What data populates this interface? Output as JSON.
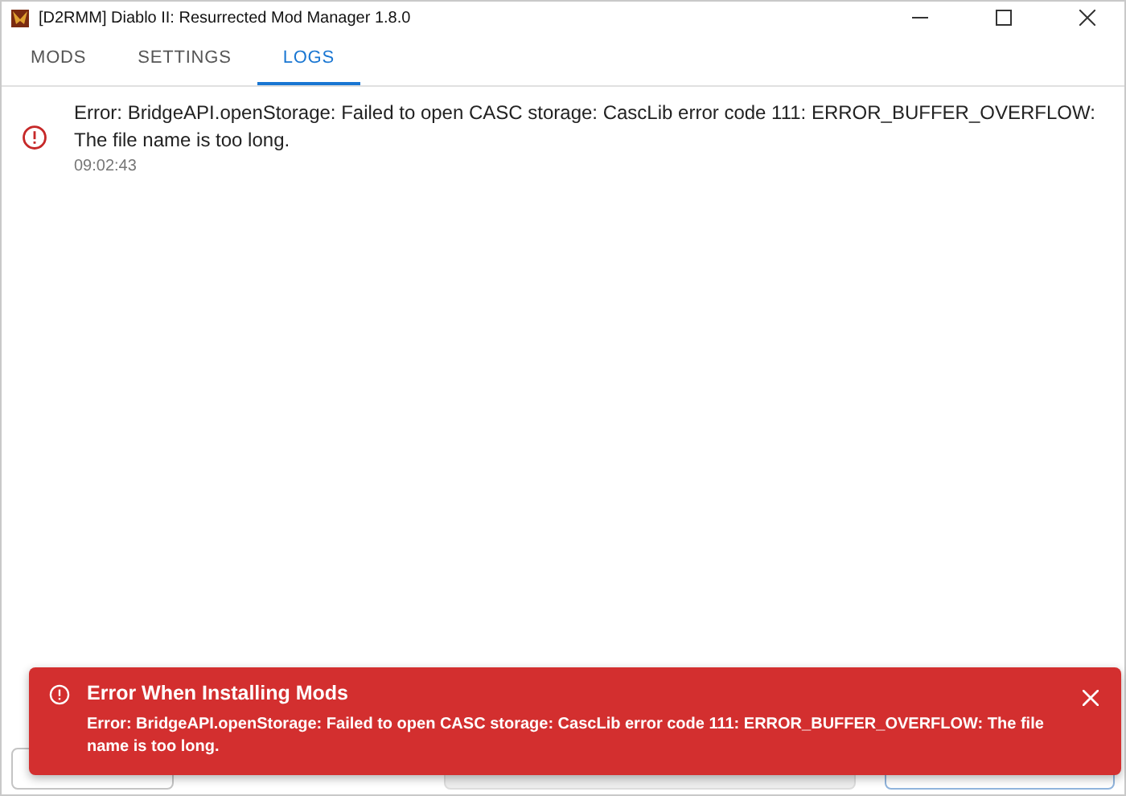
{
  "window": {
    "title": "[D2RMM] Diablo II: Resurrected Mod Manager 1.8.0"
  },
  "tabs": [
    {
      "label": "MODS",
      "selected": false
    },
    {
      "label": "SETTINGS",
      "selected": false
    },
    {
      "label": "LOGS",
      "selected": true
    }
  ],
  "logs": [
    {
      "kind": "error",
      "message": "Error: BridgeAPI.openStorage: Failed to open CASC storage: CascLib error code 111: ERROR_BUFFER_OVERFLOW: The file name is too long.",
      "time": "09:02:43"
    }
  ],
  "toast": {
    "title": "Error When Installing Mods",
    "message": "Error: BridgeAPI.openStorage: Failed to open CASC storage: CascLib error code 111: ERROR_BUFFER_OVERFLOW: The file name is too long."
  }
}
